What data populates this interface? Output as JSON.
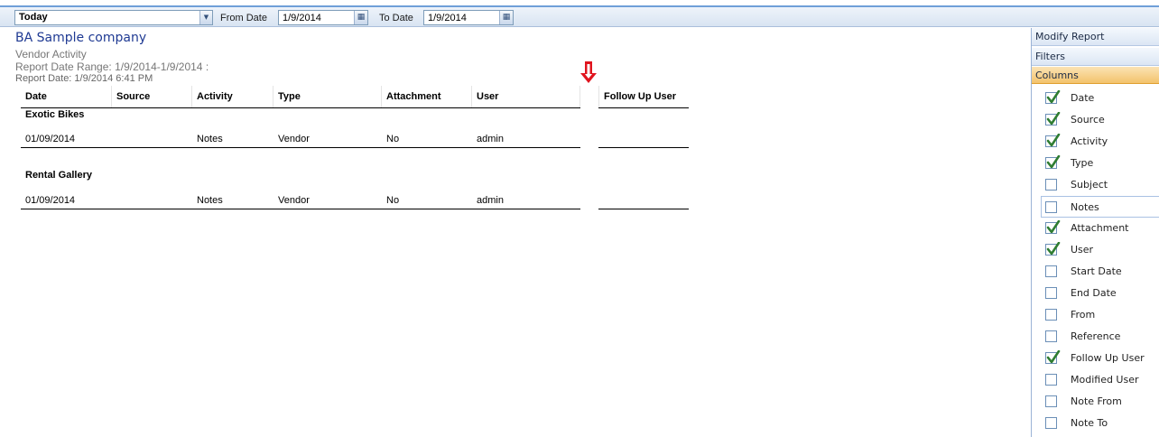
{
  "filter_bar": {
    "period_value": "Today",
    "from_label": "From Date",
    "from_value": "1/9/2014",
    "to_label": "To Date",
    "to_value": "1/9/2014"
  },
  "report": {
    "company": "BA Sample company",
    "name": "Vendor Activity",
    "date_range": "Report Date Range: 1/9/2014-1/9/2014 :",
    "report_date": "Report Date: 1/9/2014 6:41 PM"
  },
  "table": {
    "headers": [
      "Date",
      "Source",
      "Activity",
      "Type",
      "Attachment",
      "User"
    ],
    "follow_up_header": "Follow Up User",
    "groups": [
      {
        "name": "Exotic Bikes",
        "rows": [
          [
            "01/09/2014",
            "",
            "Notes",
            "Vendor",
            "No",
            "admin"
          ]
        ]
      },
      {
        "name": "Rental Gallery",
        "rows": [
          [
            "01/09/2014",
            "",
            "Notes",
            "Vendor",
            "No",
            "admin"
          ]
        ]
      }
    ]
  },
  "panel": {
    "modify_report": "Modify Report",
    "filters": "Filters",
    "columns": "Columns",
    "column_items": [
      {
        "label": "Date",
        "checked": true
      },
      {
        "label": "Source",
        "checked": true
      },
      {
        "label": "Activity",
        "checked": true
      },
      {
        "label": "Type",
        "checked": true
      },
      {
        "label": "Subject",
        "checked": false
      },
      {
        "label": "Notes",
        "checked": false
      },
      {
        "label": "Attachment",
        "checked": true
      },
      {
        "label": "User",
        "checked": true
      },
      {
        "label": "Start Date",
        "checked": false
      },
      {
        "label": "End Date",
        "checked": false
      },
      {
        "label": "From",
        "checked": false
      },
      {
        "label": "Reference",
        "checked": false
      },
      {
        "label": "Follow Up User",
        "checked": true
      },
      {
        "label": "Modified User",
        "checked": false
      },
      {
        "label": "Note From",
        "checked": false
      },
      {
        "label": "Note To",
        "checked": false
      }
    ]
  },
  "colors": {
    "accent": "#1f3a93",
    "arrow": "#e0141e",
    "check": "#2f7d32"
  }
}
